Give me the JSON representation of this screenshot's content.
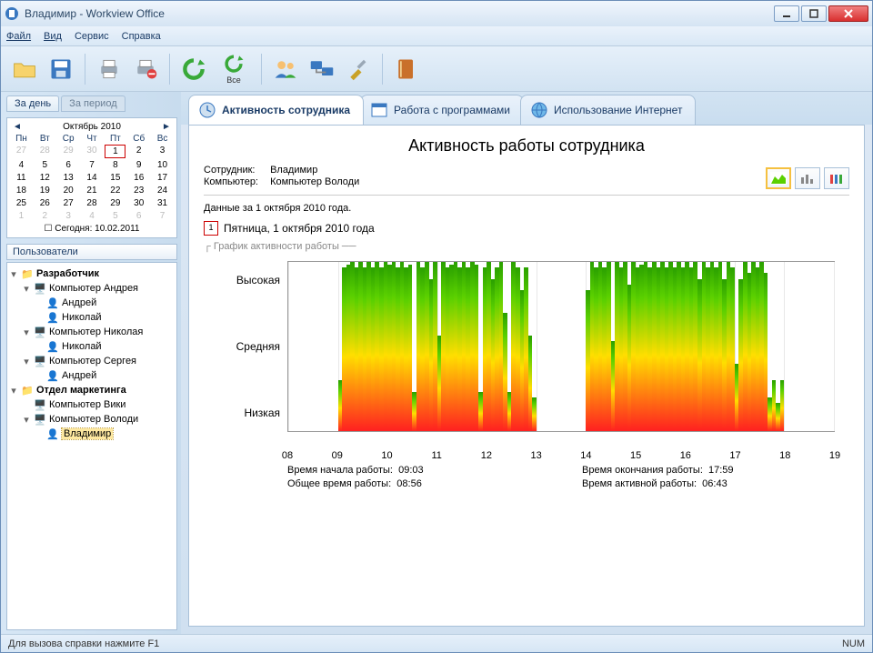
{
  "window_title": "Владимир - Workview Office",
  "menu": {
    "file": "Файл",
    "view": "Вид",
    "service": "Сервис",
    "help": "Справка"
  },
  "toolbar_all_label": "Все",
  "sidebar": {
    "tab_day": "За день",
    "tab_period": "За период",
    "calendar": {
      "title": "Октябрь 2010",
      "dow": [
        "Пн",
        "Вт",
        "Ср",
        "Чт",
        "Пт",
        "Сб",
        "Вс"
      ],
      "sel_day": "1",
      "today_label": "Сегодня: 10.02.2011"
    },
    "users_head": "Пользователи",
    "tree": {
      "g1": "Разработчик",
      "c_andrey": "Компьютер Андрея",
      "u_andrey": "Андрей",
      "u_nikolay": "Николай",
      "c_nikolay": "Компьютер Николая",
      "c_sergey": "Компьютер Сергея",
      "g2": "Отдел маркетинга",
      "c_viki": "Компьютер Вики",
      "c_volodi": "Компьютер Володи",
      "u_vladimir": "Владимир"
    }
  },
  "tabs": {
    "activity": "Активность сотрудника",
    "programs": "Работа с программами",
    "internet": "Использование Интернет"
  },
  "page": {
    "title": "Активность работы сотрудника",
    "emp_k": "Сотрудник:",
    "emp_v": "Владимир",
    "comp_k": "Компьютер:",
    "comp_v": "Компьютер Володи",
    "data_for": "Данные за 1 октября 2010 года.",
    "dateline": "Пятница, 1 октября 2010 года",
    "section": "График активности работы",
    "y_high": "Высокая",
    "y_mid": "Средняя",
    "y_low": "Низкая",
    "start_k": "Время начала работы:",
    "start_v": "09:03",
    "end_k": "Время окончания работы:",
    "end_v": "17:59",
    "total_k": "Общее время работы:",
    "total_v": "08:56",
    "active_k": "Время активной работы:",
    "active_v": "06:43"
  },
  "statusbar": {
    "help": "Для вызова справки нажмите F1",
    "num": "NUM"
  },
  "chart_data": {
    "type": "area",
    "title": "График активности работы",
    "xlabel": "",
    "ylabel": "",
    "x_ticks": [
      "08",
      "09",
      "10",
      "11",
      "12",
      "13",
      "14",
      "15",
      "16",
      "17",
      "18",
      "19"
    ],
    "x_range": [
      8,
      19
    ],
    "y_levels": [
      "Низкая",
      "Средняя",
      "Высокая"
    ],
    "ylim": [
      0,
      3
    ],
    "series": [
      {
        "name": "activity",
        "x_step_min": 5,
        "x_start": 8.0,
        "values": [
          0,
          0,
          0,
          0,
          0,
          0,
          0,
          0,
          0,
          0,
          0,
          0,
          0.9,
          2.9,
          2.95,
          3,
          2.9,
          3,
          2.9,
          3,
          2.9,
          3,
          2.9,
          3,
          2.95,
          3,
          2.9,
          3,
          2.9,
          2.95,
          0.7,
          3,
          2.9,
          3,
          2.7,
          3,
          1.7,
          3,
          2.9,
          2.95,
          3,
          2.9,
          3,
          2.9,
          3,
          2.95,
          0.7,
          2.9,
          3,
          2.7,
          2.9,
          3,
          2.1,
          0.7,
          3,
          2.9,
          2.5,
          2.9,
          1.7,
          0.6,
          0,
          0,
          0,
          0,
          0,
          0,
          0,
          0,
          0,
          0,
          0,
          0,
          2.5,
          3,
          2.9,
          3,
          2.9,
          3,
          1.6,
          3,
          2.9,
          3,
          2.6,
          3,
          2.9,
          2.95,
          3,
          2.9,
          3,
          2.9,
          3,
          2.9,
          3,
          2.9,
          3,
          2.9,
          3,
          2.9,
          3,
          2.7,
          3,
          2.9,
          3,
          2.9,
          3,
          2.7,
          3,
          2.9,
          1.2,
          2.7,
          3,
          2.8,
          3,
          2.9,
          3,
          2.8,
          0.6,
          0.9,
          0.5,
          0.9,
          0,
          0,
          0,
          0,
          0,
          0,
          0,
          0,
          0,
          0,
          0,
          0
        ]
      }
    ]
  }
}
